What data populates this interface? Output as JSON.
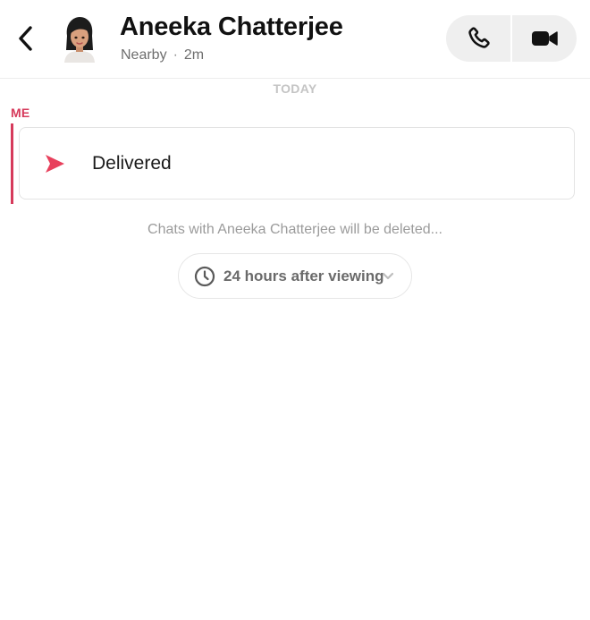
{
  "header": {
    "contact_name": "Aneeka Chatterjee",
    "status_location": "Nearby",
    "status_separator": "·",
    "status_time": "2m"
  },
  "icons": {
    "back": "chevron-left-icon",
    "avatar": "bitmoji-avatar",
    "call": "phone-icon",
    "video": "video-camera-icon",
    "sent": "sent-arrow-icon",
    "timer": "clock-icon",
    "dropdown": "chevron-down-icon"
  },
  "conversation": {
    "day_label": "TODAY",
    "sender_label": "ME",
    "message_status": "Delivered",
    "delete_notice": "Chats with Aneeka Chatterjee will be deleted...",
    "delete_timer_option": "24 hours after viewing"
  },
  "colors": {
    "accent": "#d63a5b",
    "sent_arrow": "#e8405c",
    "button_bg": "#efefef"
  }
}
